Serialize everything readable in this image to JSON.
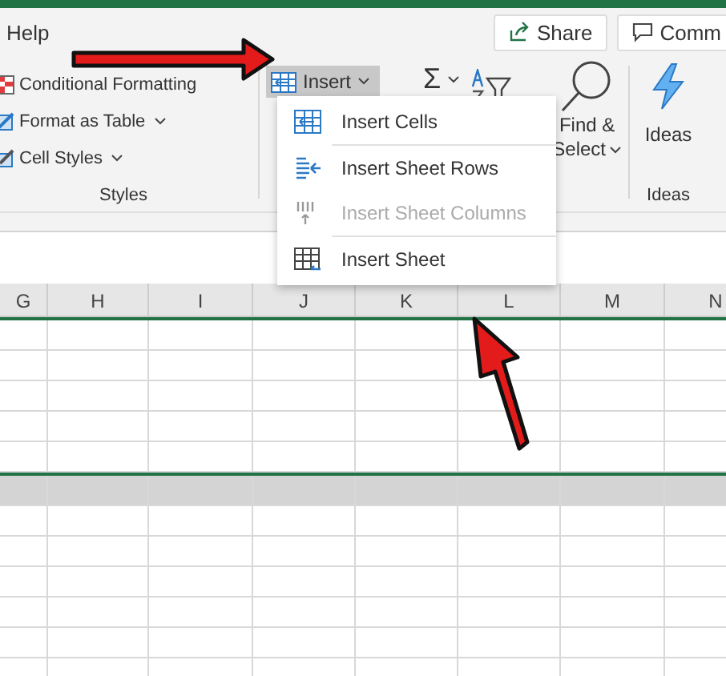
{
  "menu_tab": {
    "label": "Help"
  },
  "header_buttons": [
    {
      "kind": "share",
      "label": "Share"
    },
    {
      "kind": "comment",
      "label": "Comm"
    }
  ],
  "styles_group": {
    "label": "Styles",
    "items": [
      {
        "kind": "conditional",
        "label": "Conditional Formatting",
        "dropdown": false
      },
      {
        "kind": "table",
        "label": "Format as Table",
        "dropdown": true
      },
      {
        "kind": "styles",
        "label": "Cell Styles",
        "dropdown": true
      }
    ]
  },
  "insert_button": {
    "label": "Insert",
    "expanded": true
  },
  "editing": {
    "sum_symbol": "Σ",
    "find_label": [
      "Find &",
      "Select"
    ]
  },
  "ideas": {
    "label": "Ideas",
    "group_label": "Ideas"
  },
  "insert_menu": [
    {
      "kind": "cells",
      "label": "Insert Cells",
      "disabled": false,
      "separator_before": false
    },
    {
      "kind": "rows",
      "label": "Insert Sheet Rows",
      "disabled": false,
      "separator_before": true
    },
    {
      "kind": "columns",
      "label": "Insert Sheet Columns",
      "disabled": true,
      "separator_before": false
    },
    {
      "kind": "sheet",
      "label": "Insert Sheet",
      "disabled": false,
      "separator_before": true
    }
  ],
  "columns": [
    "G",
    "H",
    "I",
    "J",
    "K",
    "L",
    "M",
    "N"
  ],
  "selected_rows": [
    {
      "highlighted": false
    },
    {
      "highlighted": false
    },
    {
      "highlighted": false
    },
    {
      "highlighted": false
    },
    {
      "highlighted": false
    }
  ],
  "rows": [
    {
      "highlighted": true
    },
    {
      "highlighted": false
    },
    {
      "highlighted": false
    },
    {
      "highlighted": false
    },
    {
      "highlighted": false
    },
    {
      "highlighted": false
    },
    {
      "highlighted": false
    }
  ]
}
